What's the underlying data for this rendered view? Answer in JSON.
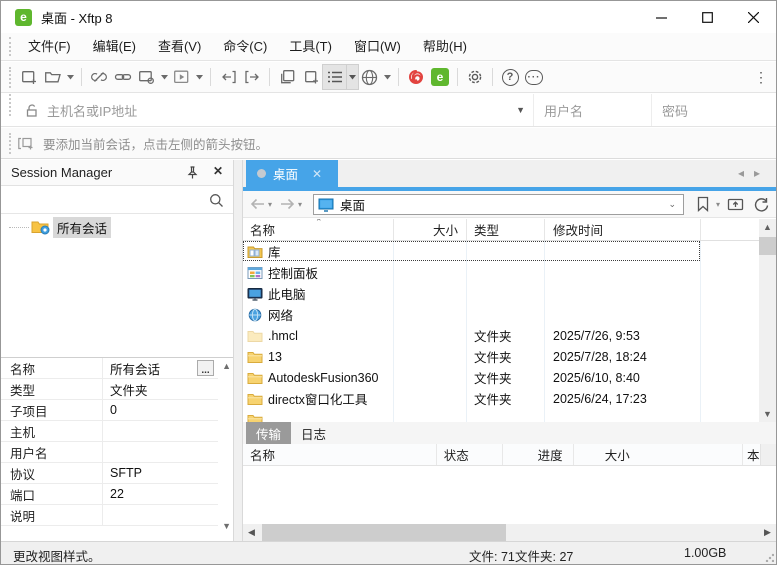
{
  "titlebar": {
    "title": "桌面 - Xftp 8",
    "app_badge": "e"
  },
  "menubar": {
    "items": [
      "文件(F)",
      "编辑(E)",
      "查看(V)",
      "命令(C)",
      "工具(T)",
      "窗口(W)",
      "帮助(H)"
    ]
  },
  "connectbar": {
    "host_placeholder": "主机名或IP地址",
    "username_placeholder": "用户名",
    "password_placeholder": "密码"
  },
  "hintbar": {
    "text": "要添加当前会话，点击左侧的箭头按钮。"
  },
  "session_manager": {
    "title": "Session Manager",
    "tree_items": [
      {
        "label": "所有会话",
        "icon": "sessions-folder-icon",
        "selected": true
      }
    ],
    "properties": [
      {
        "label": "名称",
        "value": "所有会话"
      },
      {
        "label": "类型",
        "value": "文件夹"
      },
      {
        "label": "子项目",
        "value": "0"
      },
      {
        "label": "主机",
        "value": ""
      },
      {
        "label": "用户名",
        "value": ""
      },
      {
        "label": "协议",
        "value": "SFTP"
      },
      {
        "label": "端口",
        "value": "22"
      },
      {
        "label": "说明",
        "value": ""
      }
    ],
    "more_button_label": "..."
  },
  "remote_panel": {
    "tab_label": "桌面",
    "address_value": "桌面",
    "file_columns": [
      "名称",
      "大小",
      "类型",
      "修改时间"
    ],
    "files": [
      {
        "name": "库",
        "size": "",
        "type": "",
        "mtime": "",
        "icon": "library-icon",
        "selected": true
      },
      {
        "name": "控制面板",
        "size": "",
        "type": "",
        "mtime": "",
        "icon": "control-panel-icon"
      },
      {
        "name": "此电脑",
        "size": "",
        "type": "",
        "mtime": "",
        "icon": "computer-icon"
      },
      {
        "name": "网络",
        "size": "",
        "type": "",
        "mtime": "",
        "icon": "network-icon"
      },
      {
        "name": ".hmcl",
        "size": "",
        "type": "文件夹",
        "mtime": "2025/7/26, 9:53",
        "icon": "hidden-folder-icon"
      },
      {
        "name": "13",
        "size": "",
        "type": "文件夹",
        "mtime": "2025/7/28, 18:24",
        "icon": "folder-icon"
      },
      {
        "name": "AutodeskFusion360",
        "size": "",
        "type": "文件夹",
        "mtime": "2025/6/10, 8:40",
        "icon": "folder-icon"
      },
      {
        "name": "directx窗口化工具",
        "size": "",
        "type": "文件夹",
        "mtime": "2025/6/24, 17:23",
        "icon": "folder-icon"
      },
      {
        "name": "",
        "size": "",
        "type": "",
        "mtime": "",
        "icon": "folder-icon"
      }
    ]
  },
  "transfer_panel": {
    "tabs": [
      {
        "label": "传输",
        "active": true
      },
      {
        "label": "日志",
        "active": false
      }
    ],
    "columns": [
      "名称",
      "状态",
      "进度",
      "大小",
      "本"
    ]
  },
  "statusbar": {
    "left": "更改视图样式。",
    "files": "文件: 71",
    "folders": "文件夹: 27",
    "size": "1.00GB"
  }
}
